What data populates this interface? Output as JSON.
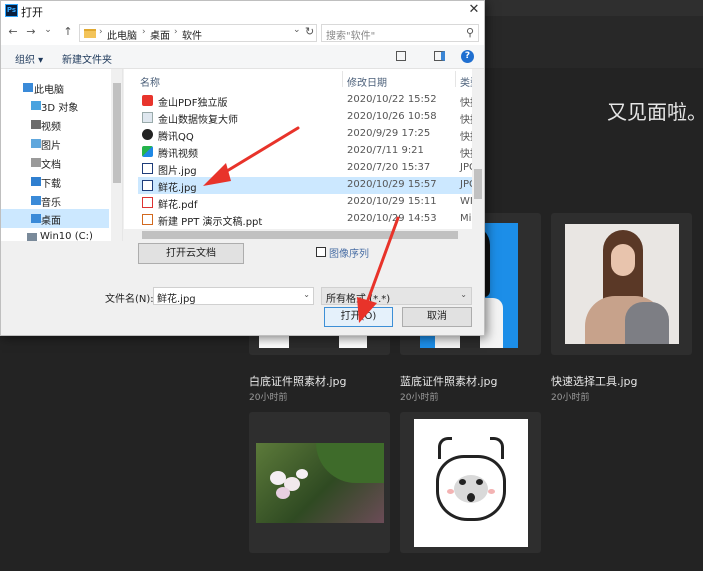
{
  "dialog": {
    "app_icon_text": "Ps",
    "title": "打开",
    "close_glyph": "✕",
    "nav": {
      "back": "←",
      "forward": "→",
      "recent": "⌄",
      "up": "↑"
    },
    "breadcrumb": [
      "此电脑",
      "桌面",
      "软件"
    ],
    "breadcrumb_sep": "›",
    "address_dropdown": "⌄",
    "refresh": "↻",
    "search_placeholder": "搜索\"软件\"",
    "search_icon": "⚲",
    "toolbar": {
      "organize": "组织 ▾",
      "new_folder": "新建文件夹",
      "help": "?"
    },
    "nav_items": [
      {
        "label": "此电脑",
        "icon": "computer-icon",
        "selected": false
      },
      {
        "label": "3D 对象",
        "icon": "3d-objects-icon",
        "selected": false
      },
      {
        "label": "视频",
        "icon": "video-folder-icon",
        "selected": false
      },
      {
        "label": "图片",
        "icon": "pictures-folder-icon",
        "selected": false
      },
      {
        "label": "文档",
        "icon": "documents-folder-icon",
        "selected": false
      },
      {
        "label": "下载",
        "icon": "downloads-folder-icon",
        "selected": false
      },
      {
        "label": "音乐",
        "icon": "music-folder-icon",
        "selected": false
      },
      {
        "label": "桌面",
        "icon": "desktop-folder-icon",
        "selected": true
      },
      {
        "label": "Win10 (C:)",
        "icon": "drive-icon",
        "selected": false
      }
    ],
    "columns": {
      "name": "名称",
      "modified": "修改日期",
      "type": "类型"
    },
    "files": [
      {
        "name": "金山PDF独立版",
        "date": "2020/10/22 15:52",
        "type": "快捷",
        "icon": "pdf-app-icon",
        "selected": false
      },
      {
        "name": "金山数据恢复大师",
        "date": "2020/10/26 10:58",
        "type": "快捷",
        "icon": "shortcut-icon",
        "selected": false
      },
      {
        "name": "腾讯QQ",
        "date": "2020/9/29 17:25",
        "type": "快捷",
        "icon": "qq-icon",
        "selected": false
      },
      {
        "name": "腾讯视频",
        "date": "2020/7/11 9:21",
        "type": "快捷",
        "icon": "video-app-icon",
        "selected": false
      },
      {
        "name": "图片.jpg",
        "date": "2020/7/20 15:37",
        "type": "JPG",
        "icon": "image-file-icon",
        "selected": false
      },
      {
        "name": "鲜花.jpg",
        "date": "2020/10/29 15:57",
        "type": "JPG",
        "icon": "image-file-icon",
        "selected": true
      },
      {
        "name": "鲜花.pdf",
        "date": "2020/10/29 15:11",
        "type": "WI",
        "icon": "pdf-file-icon",
        "selected": false
      },
      {
        "name": "新建 PPT 演示文稿.ppt",
        "date": "2020/10/29 14:53",
        "type": "Mi",
        "icon": "ppt-file-icon",
        "selected": false
      }
    ],
    "cloud_button": "打开云文档",
    "image_sequence_label": "图像序列",
    "filename_label": "文件名(N):",
    "filename_value": "鲜花.jpg",
    "dropdown_glyph": "⌄",
    "filter_value": "所有格式 (*.*)",
    "open_button": "打开(O)",
    "cancel_button": "取消",
    "accent_color": "#3d8fd6",
    "selection_color": "#cce8ff"
  },
  "photoshop": {
    "welcome_text": "又见面啦。",
    "recent_files": [
      {
        "name": "白底证件照素材.jpg",
        "time": "20小时前",
        "thumb": "white-id-photo"
      },
      {
        "name": "蓝底证件照素材.jpg",
        "time": "20小时前",
        "thumb": "blue-id-photo"
      },
      {
        "name": "快速选择工具.jpg",
        "time": "20小时前",
        "thumb": "woman-portrait"
      },
      {
        "name": "",
        "time": "",
        "thumb": "flower-photo"
      },
      {
        "name": "",
        "time": "",
        "thumb": "cartoon-face"
      }
    ],
    "arrow_color": "#e8332a"
  }
}
